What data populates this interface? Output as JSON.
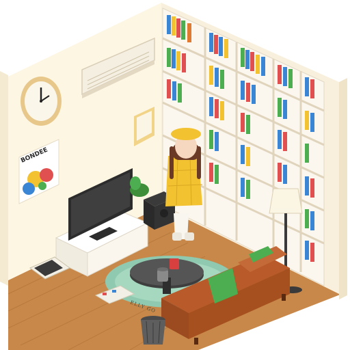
{
  "scene": {
    "poster_text": "BONDEE",
    "rug_text": "ELLY GO"
  }
}
